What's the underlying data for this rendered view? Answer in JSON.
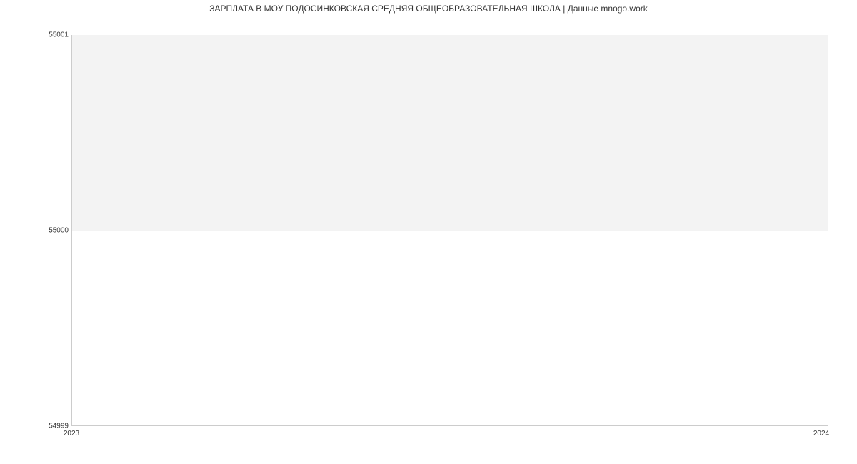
{
  "chart_data": {
    "type": "area",
    "title": "ЗАРПЛАТА В МОУ ПОДОСИНКОВСКАЯ СРЕДНЯЯ ОБЩЕОБРАЗОВАТЕЛЬНАЯ ШКОЛА | Данные mnogo.work",
    "x": [
      "2023",
      "2024"
    ],
    "values": [
      55000,
      55000
    ],
    "ylim": [
      54999,
      55001
    ],
    "y_ticks": [
      "54999",
      "55000",
      "55001"
    ],
    "x_ticks": [
      "2023",
      "2024"
    ],
    "line_color": "#6495ed",
    "fill_color": "#f3f3f3"
  }
}
